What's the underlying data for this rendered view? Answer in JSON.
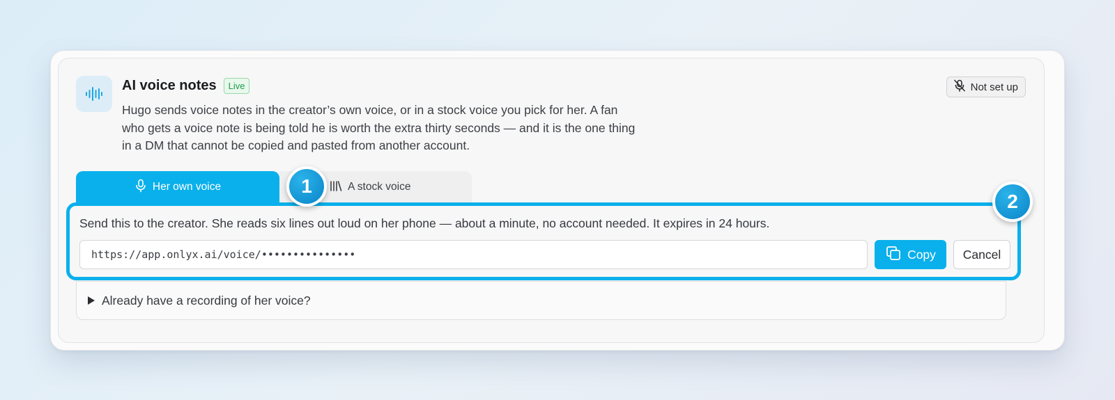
{
  "feature": {
    "title": "AI voice notes",
    "badge": "Live",
    "status": "Not set up",
    "description": "Hugo sends voice notes in the creator’s own voice, or in a stock voice you pick for her. A fan who gets a voice note is being told he is worth the extra thirty seconds — and it is the one thing in a DM that cannot be copied and pasted from another account.",
    "icon": "waveform-icon",
    "status_icon": "mic-off-icon"
  },
  "tabs": [
    {
      "label": "Her own voice",
      "icon": "microphone-icon",
      "active": true
    },
    {
      "label": "A stock voice",
      "icon": "library-icon",
      "active": false
    }
  ],
  "steps": [
    "1",
    "2"
  ],
  "share": {
    "instruction": "Send this to the creator. She reads six lines out loud on her phone — about a minute, no account needed. It expires in 24 hours.",
    "url": "https://app.onlyx.ai/voice/•••••••••••••••",
    "copy_label": "Copy",
    "cancel_label": "Cancel"
  },
  "accordion": {
    "label": "Already have a recording of her voice?"
  },
  "colors": {
    "accent": "#0ab0eb",
    "live_green": "#1f9d49"
  }
}
